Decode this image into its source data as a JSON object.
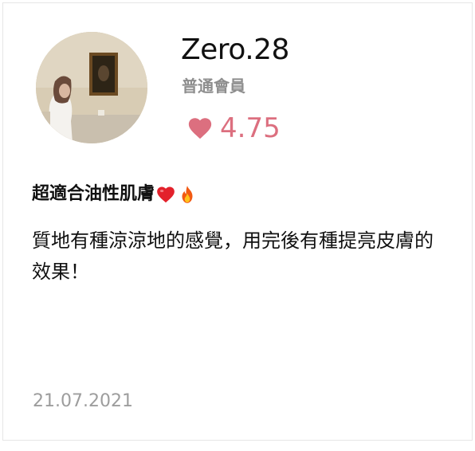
{
  "user": {
    "name": "Zero.28",
    "membership": "普通會員",
    "avatar": "profile-photo-museum"
  },
  "rating": {
    "icon": "heart-icon",
    "value": "4.75",
    "color": "#dc6f7f"
  },
  "review": {
    "title": "超適合油性肌膚",
    "title_emojis": [
      "red-heart-emoji",
      "fire-emoji"
    ],
    "body": "質地有種涼涼地的感覺，用完後有種提亮皮膚的效果！",
    "date": "21.07.2021"
  }
}
